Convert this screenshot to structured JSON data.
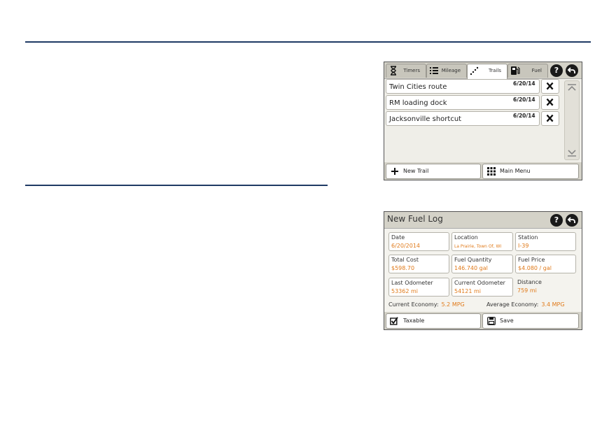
{
  "trails_screen": {
    "tabs": [
      {
        "label": "Timers",
        "icon": "hourglass-icon"
      },
      {
        "label": "Mileage",
        "icon": "list-icon"
      },
      {
        "label": "Trails",
        "icon": "trail-dots-icon",
        "active": true
      },
      {
        "label": "Fuel",
        "icon": "fuel-pump-icon"
      }
    ],
    "help_symbol": "?",
    "trails": [
      {
        "name": "Twin Cities route",
        "date": "6/20/14"
      },
      {
        "name": "RM loading dock",
        "date": "6/20/14"
      },
      {
        "name": "Jacksonville shortcut",
        "date": "6/20/14"
      }
    ],
    "new_trail_label": "New Trail",
    "main_menu_label": "Main Menu"
  },
  "fuel_screen": {
    "title": "New Fuel Log",
    "help_symbol": "?",
    "fields": {
      "date": {
        "label": "Date",
        "value": "6/20/2014"
      },
      "location": {
        "label": "Location",
        "value": "La Prairie, Town Of, WI"
      },
      "station": {
        "label": "Station",
        "value": "I-39"
      },
      "total_cost": {
        "label": "Total Cost",
        "value": "$598.70"
      },
      "fuel_quantity": {
        "label": "Fuel Quantity",
        "value": "146.740 gal"
      },
      "fuel_price": {
        "label": "Fuel Price",
        "value": "$4.080 / gal"
      },
      "last_odometer": {
        "label": "Last Odometer",
        "value": "53362 mi"
      },
      "current_odometer": {
        "label": "Current Odometer",
        "value": "54121 mi"
      },
      "distance": {
        "label": "Distance",
        "value": "759 mi"
      }
    },
    "current_economy": {
      "label": "Current Economy:",
      "value": "5.2 MPG"
    },
    "average_economy": {
      "label": "Average Economy:",
      "value": "3.4 MPG"
    },
    "taxable_label": "Taxable",
    "taxable_checked": true,
    "save_label": "Save"
  },
  "colors": {
    "rule": "#1f3a64",
    "value_text": "#e07a1a"
  }
}
